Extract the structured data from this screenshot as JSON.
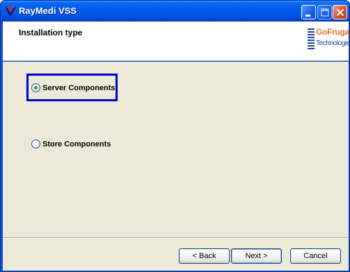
{
  "window": {
    "title": "RayMedi VSS",
    "icon": "raymedi-app-icon",
    "controls": {
      "minimize_icon": "minimize-icon",
      "maximize_icon": "maximize-icon",
      "close_icon": "close-icon"
    },
    "title_bar_color": "#0055e5"
  },
  "header": {
    "title": "Installation type",
    "logo": {
      "line1": "GoFrugal",
      "line2": "Technologies",
      "accent_color": "#e87722",
      "brand_color": "#1e3f9a"
    }
  },
  "options": [
    {
      "label": "Server Components",
      "selected": true
    },
    {
      "label": "Store Components",
      "selected": false
    }
  ],
  "highlight_color": "#0000cc",
  "footer": {
    "back_label": "< Back",
    "next_label": "Next >",
    "cancel_label": "Cancel"
  }
}
